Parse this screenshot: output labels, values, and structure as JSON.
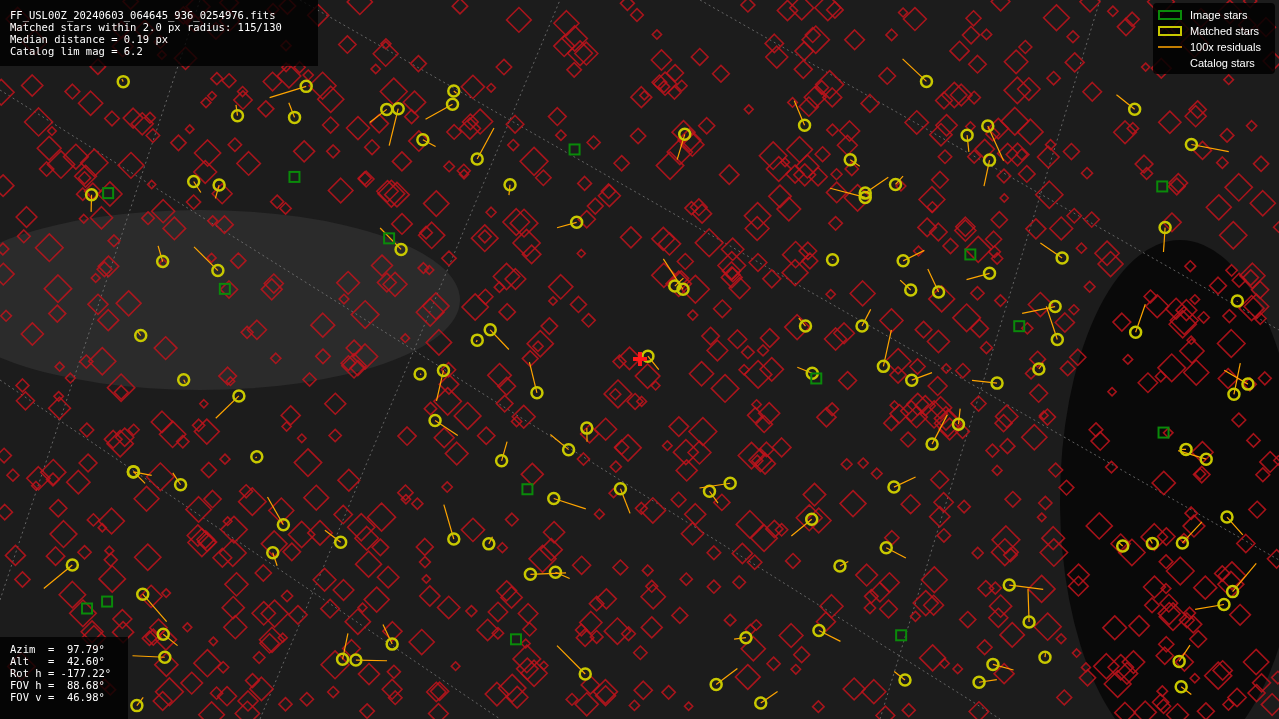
{
  "info_panel": {
    "lines": [
      "FF_USL00Z_20240603_064645_936_0254976.fits",
      "Matched stars within 2.0 px radius: 115/130",
      "Median distance = 0.19 px",
      "Catalog lim mag = 6.2"
    ]
  },
  "legend": {
    "items": [
      {
        "kind": "image",
        "label": "Image stars"
      },
      {
        "kind": "matched",
        "label": "Matched stars"
      },
      {
        "kind": "residual",
        "label": "100x residuals"
      },
      {
        "kind": "catalog",
        "label": "Catalog stars"
      }
    ]
  },
  "pointing_panel": {
    "lines": [
      "Azim  =  97.79°",
      "Alt   =  42.60°",
      "Rot h = -177.22°",
      "FOV h =  88.68°",
      "FOV v =  46.98°"
    ]
  }
}
